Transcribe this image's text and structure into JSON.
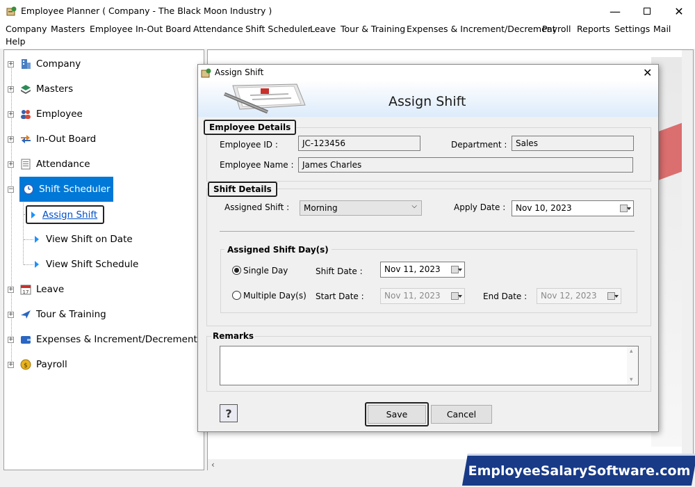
{
  "window": {
    "title": "Employee Planner ( Company - The Black Moon Industry )"
  },
  "menu": [
    "Company",
    "Masters",
    "Employee",
    "In-Out Board",
    "Attendance",
    "Shift Scheduler",
    "Leave",
    "Tour & Training",
    "Expenses & Increment/Decrement",
    "Payroll",
    "Reports",
    "Settings",
    "Mail",
    "Help"
  ],
  "tree": {
    "nodes": [
      "Company",
      "Masters",
      "Employee",
      "In-Out Board",
      "Attendance",
      "Shift Scheduler",
      "Leave",
      "Tour & Training",
      "Expenses & Increment/Decrement",
      "Payroll"
    ],
    "children": [
      "Assign Shift",
      "View Shift on Date",
      "View Shift Schedule"
    ]
  },
  "dialog": {
    "title": "Assign Shift",
    "heading": "Assign Shift",
    "employee_group": "Employee Details",
    "employee_id_label": "Employee ID :",
    "employee_id": "JC-123456",
    "department_label": "Department :",
    "department": "Sales",
    "employee_name_label": "Employee Name :",
    "employee_name": "James Charles",
    "shift_group": "Shift Details",
    "assigned_shift_label": "Assigned Shift :",
    "assigned_shift": "Morning",
    "apply_date_label": "Apply Date :",
    "apply_date": "Nov 10, 2023",
    "days_group": "Assigned Shift Day(s)",
    "single_day_label": "Single Day",
    "shift_date_label": "Shift Date :",
    "shift_date": "Nov 11, 2023",
    "multiple_days_label": "Multiple Day(s)",
    "start_date_label": "Start Date :",
    "start_date": "Nov 11, 2023",
    "end_date_label": "End Date :",
    "end_date": "Nov 12, 2023",
    "remarks_label": "Remarks",
    "remarks": "",
    "save_label": "Save",
    "cancel_label": "Cancel",
    "help_label": "?"
  },
  "watermark": "EmployeeSalarySoftware.com",
  "colors": {
    "selection": "#0078d7",
    "watermark_bg": "#183a87"
  }
}
